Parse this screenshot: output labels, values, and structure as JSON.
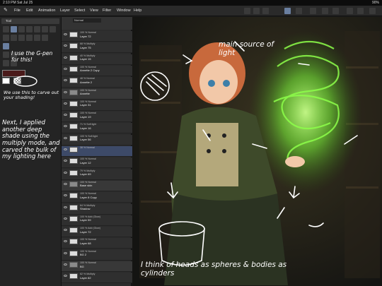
{
  "status_bar": {
    "time": "2:10 PM",
    "date": "Sat Jul 25",
    "battery": "90%"
  },
  "menu": {
    "items": [
      "File",
      "Edit",
      "Animation",
      "Layer",
      "Select",
      "View",
      "Filter",
      "Window",
      "Help"
    ]
  },
  "tool_panel": {
    "tab_label": "Tool"
  },
  "layer_panel": {
    "blend_mode": "Normal",
    "layers": [
      {
        "info": "100 % Normal",
        "name": "Layer 72"
      },
      {
        "info": "68 % Multiply",
        "name": "Layer 75"
      },
      {
        "info": "40 % Multiply",
        "name": "Layer 15"
      },
      {
        "info": "100 % Normal",
        "name": "Annette 2 Copy"
      },
      {
        "info": "48 % Normal",
        "name": "Annette 2"
      },
      {
        "info": "100 % Normal",
        "name": "Annette",
        "folder": true
      },
      {
        "info": "100 % Normal",
        "name": "Layer 31"
      },
      {
        "info": "100 % Normal",
        "name": "Layer 19"
      },
      {
        "info": "71 % Soft light",
        "name": "Layer 16"
      },
      {
        "info": "100 % Soft light",
        "name": "Layer 56"
      },
      {
        "info": "38 % Normal",
        "name": "",
        "selected": true
      },
      {
        "info": "100 % Normal",
        "name": "Layer 12"
      },
      {
        "info": "79 % Multiply",
        "name": "Layer 69"
      },
      {
        "info": "100 % Normal",
        "name": "Base skin",
        "folder": true
      },
      {
        "info": "100 % Normal",
        "name": "Layer 8 Copy"
      },
      {
        "info": "64 % Multiply",
        "name": "Shadow"
      },
      {
        "info": "100 % Add (Glow)",
        "name": "Layer 59"
      },
      {
        "info": "100 % Add (Glow)",
        "name": "Layer 72"
      },
      {
        "info": "100 % Normal",
        "name": "Layer 68"
      },
      {
        "info": "100 % Normal",
        "name": "BG 2"
      },
      {
        "info": "100 % Normal",
        "name": "BG",
        "folder": true
      },
      {
        "info": "62 % Multiply",
        "name": "Layer 82"
      }
    ]
  },
  "annotations": {
    "gpen_note": "I use the G-pen for this!",
    "carve_note": "We use this to carve out your shading!",
    "multiply_note": "Next, I applied another deep shade using the multiply mode, and carved the bulk of my lighting here",
    "light_note": "main source of light",
    "shapes_note": "I think of heads as spheres & bodies as cylinders"
  },
  "colors": {
    "accent": "#6a7fa0",
    "glow": "#7dff3a",
    "swatch_main": "#4a1a1a"
  }
}
